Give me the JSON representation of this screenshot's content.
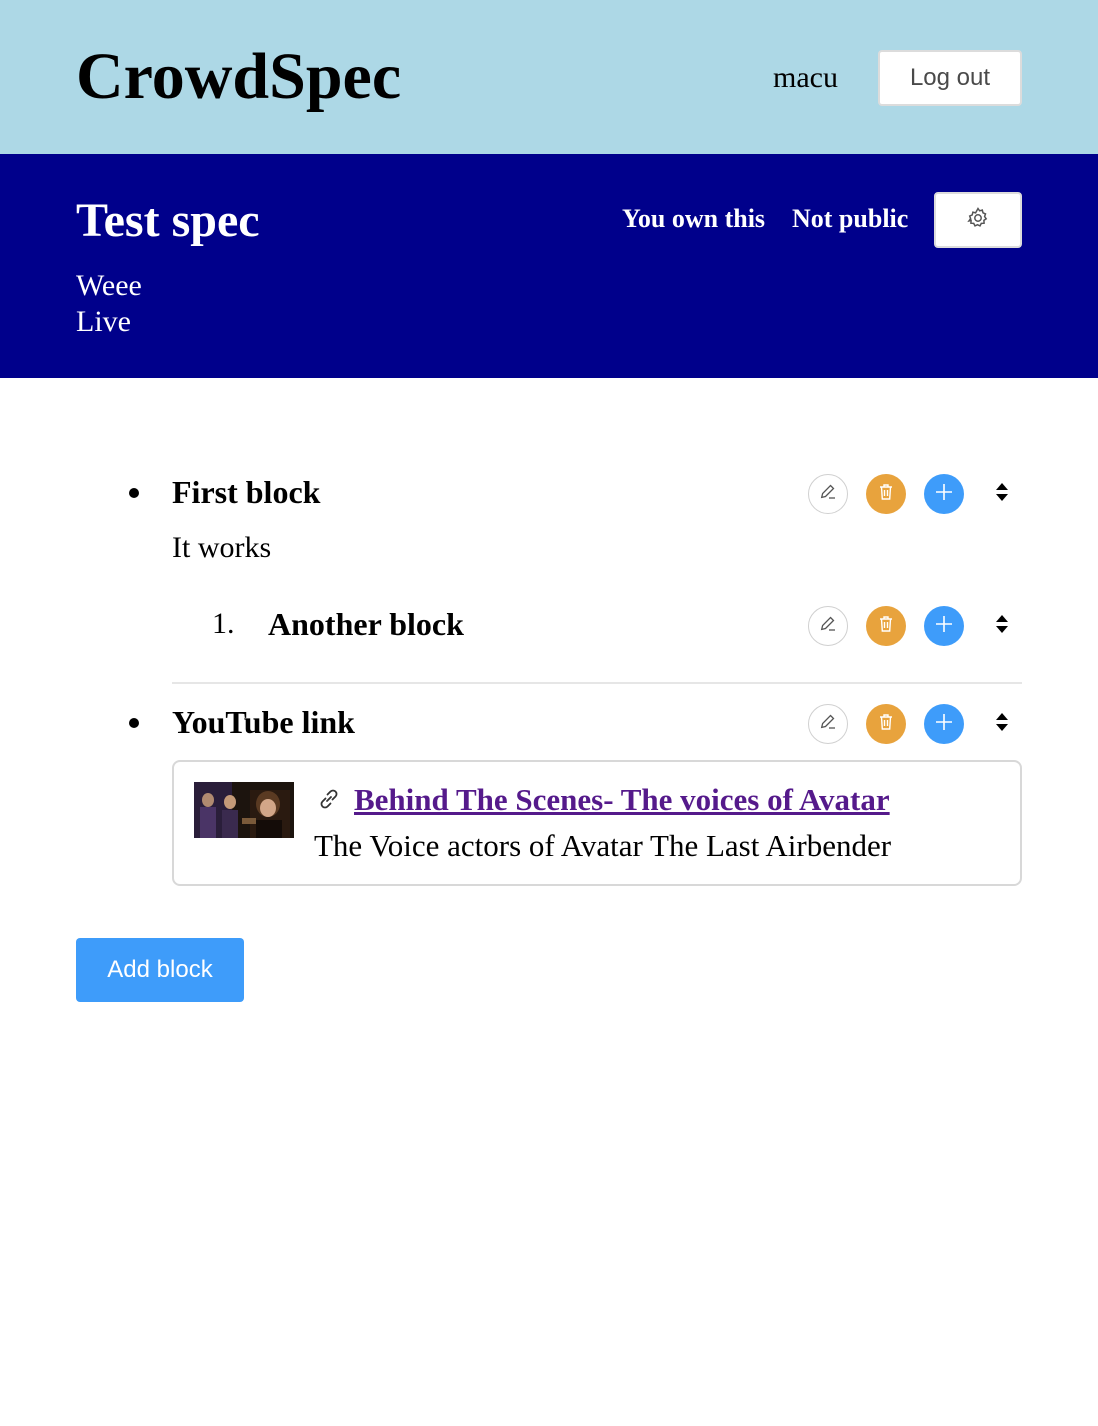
{
  "header": {
    "brand": "CrowdSpec",
    "username": "macu",
    "logout_label": "Log out",
    "background": "#add8e6"
  },
  "spec": {
    "title": "Test spec",
    "description_lines": [
      "Weee",
      "Live"
    ],
    "owner_status": "You own this",
    "visibility": "Not public",
    "settings_icon": "gear-icon",
    "background": "#00008b"
  },
  "blocks": [
    {
      "title": "First block",
      "body": "It works",
      "children": [
        {
          "number": "1.",
          "title": "Another block"
        }
      ]
    },
    {
      "title": "YouTube link",
      "link": {
        "icon": "link-icon",
        "title": "Behind The Scenes- The voices of Avatar",
        "description": "The Voice actors of Avatar The Last Airbender"
      }
    }
  ],
  "block_controls": {
    "edit_icon": "pencil-icon",
    "delete_icon": "trash-icon",
    "add_icon": "plus-icon",
    "move_icon": "sort-arrows-icon",
    "delete_color": "#e8a33d",
    "add_color": "#3e9cfa"
  },
  "add_block_label": "Add block"
}
